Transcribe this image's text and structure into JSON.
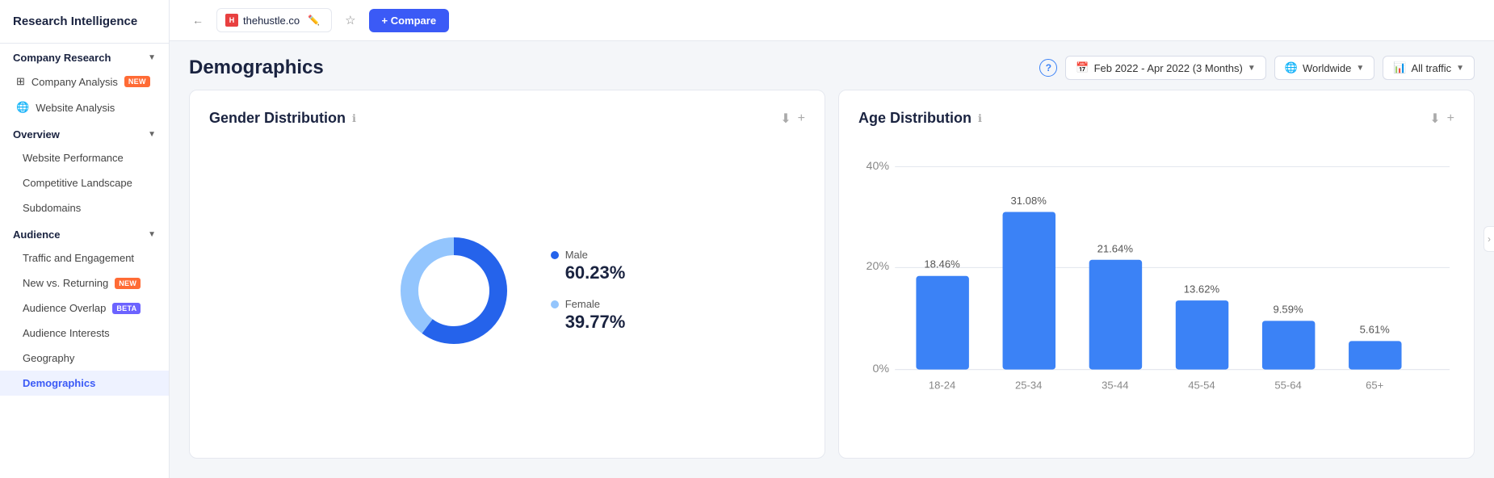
{
  "app": {
    "title": "Research Intelligence"
  },
  "sidebar": {
    "company_research_label": "Company Research",
    "sections": [
      {
        "id": "company-research",
        "label": "Company Research",
        "expanded": true,
        "items": [
          {
            "id": "company-analysis",
            "label": "Company Analysis",
            "badge": "new",
            "icon": "grid",
            "indent": false
          },
          {
            "id": "website-analysis",
            "label": "Website Analysis",
            "badge": null,
            "icon": "globe",
            "indent": false
          }
        ]
      },
      {
        "id": "overview",
        "label": "Overview",
        "expanded": true,
        "items": [
          {
            "id": "website-performance",
            "label": "Website Performance",
            "badge": null,
            "indent": true
          },
          {
            "id": "competitive-landscape",
            "label": "Competitive Landscape",
            "badge": null,
            "indent": true
          },
          {
            "id": "subdomains",
            "label": "Subdomains",
            "badge": null,
            "indent": true
          }
        ]
      },
      {
        "id": "audience",
        "label": "Audience",
        "expanded": true,
        "items": [
          {
            "id": "traffic-engagement",
            "label": "Traffic and Engagement",
            "badge": null,
            "indent": true
          },
          {
            "id": "new-vs-returning",
            "label": "New vs. Returning",
            "badge": "new",
            "indent": true
          },
          {
            "id": "audience-overlap",
            "label": "Audience Overlap",
            "badge": "beta",
            "indent": true
          },
          {
            "id": "audience-interests",
            "label": "Audience Interests",
            "badge": null,
            "indent": true
          },
          {
            "id": "geography",
            "label": "Geography",
            "badge": null,
            "indent": true
          },
          {
            "id": "demographics",
            "label": "Demographics",
            "badge": null,
            "indent": true,
            "active": true
          }
        ]
      }
    ]
  },
  "topbar": {
    "domain": "thehustle.co",
    "compare_label": "+ Compare"
  },
  "page": {
    "title": "Demographics",
    "date_range": "Feb 2022 - Apr 2022 (3 Months)",
    "region": "Worldwide",
    "traffic": "All traffic"
  },
  "gender_card": {
    "title": "Gender Distribution",
    "male_label": "Male",
    "male_pct": "60.23%",
    "female_label": "Female",
    "female_pct": "39.77%",
    "male_color": "#2563eb",
    "female_color": "#93c5fd",
    "male_value": 60.23,
    "female_value": 39.77
  },
  "age_card": {
    "title": "Age Distribution",
    "bars": [
      {
        "label": "18-24",
        "value": 18.46,
        "pct": "18.46%"
      },
      {
        "label": "25-34",
        "value": 31.08,
        "pct": "31.08%"
      },
      {
        "label": "35-44",
        "value": 21.64,
        "pct": "21.64%"
      },
      {
        "label": "45-54",
        "value": 13.62,
        "pct": "13.62%"
      },
      {
        "label": "55-64",
        "value": 9.59,
        "pct": "9.59%"
      },
      {
        "label": "65+",
        "value": 5.61,
        "pct": "5.61%"
      }
    ],
    "y_labels": [
      "40%",
      "20%",
      "0%"
    ],
    "bar_color": "#3b82f6"
  }
}
